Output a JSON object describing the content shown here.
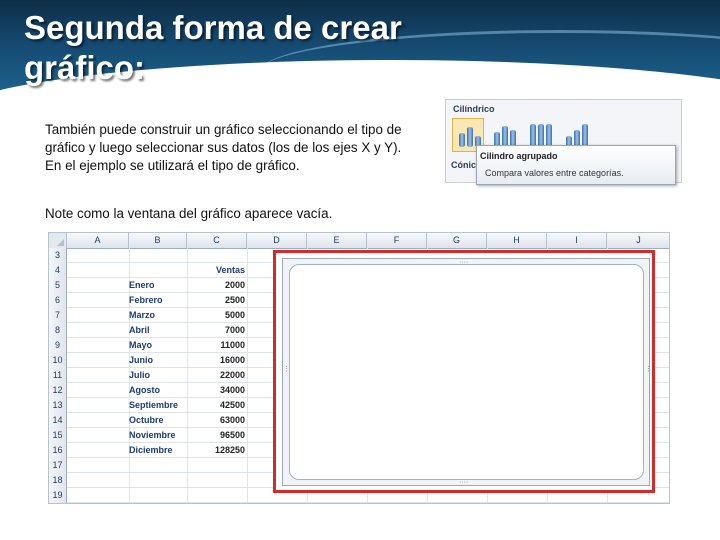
{
  "slide": {
    "title": "Segunda forma de crear gráfico:",
    "paragraph1": "También puede construir un gráfico seleccionando el tipo de gráfico y luego seleccionar sus datos (los de los ejes X y Y). En el ejemplo se utilizará el tipo de gráfico.",
    "paragraph2": "Note como la ventana del gráfico aparece vacía."
  },
  "ribbon": {
    "category": "Cilíndrico",
    "category2": "Cónic",
    "tooltip_title": "Cilindro agrupado",
    "tooltip_description": "Compara valores entre categorías."
  },
  "sheet": {
    "columns": [
      "A",
      "B",
      "C",
      "D",
      "E",
      "F",
      "G",
      "H",
      "I",
      "J"
    ],
    "row_numbers": [
      "3",
      "4",
      "5",
      "6",
      "7",
      "8",
      "9",
      "10",
      "11",
      "12",
      "13",
      "14",
      "15",
      "16",
      "17",
      "18",
      "19"
    ],
    "value_header": "Ventas",
    "data": [
      {
        "month": "Enero",
        "value": "2000"
      },
      {
        "month": "Febrero",
        "value": "2500"
      },
      {
        "month": "Marzo",
        "value": "5000"
      },
      {
        "month": "Abril",
        "value": "7000"
      },
      {
        "month": "Mayo",
        "value": "11000"
      },
      {
        "month": "Junio",
        "value": "16000"
      },
      {
        "month": "Julio",
        "value": "22000"
      },
      {
        "month": "Agosto",
        "value": "34000"
      },
      {
        "month": "Septiembre",
        "value": "42500"
      },
      {
        "month": "Octubre",
        "value": "63000"
      },
      {
        "month": "Noviembre",
        "value": "96500"
      },
      {
        "month": "Diciembre",
        "value": "128250"
      }
    ]
  },
  "colors": {
    "header_dark": "#0d2e47",
    "selection_border": "#d42a2a",
    "month_text": "#1b3b7a"
  }
}
